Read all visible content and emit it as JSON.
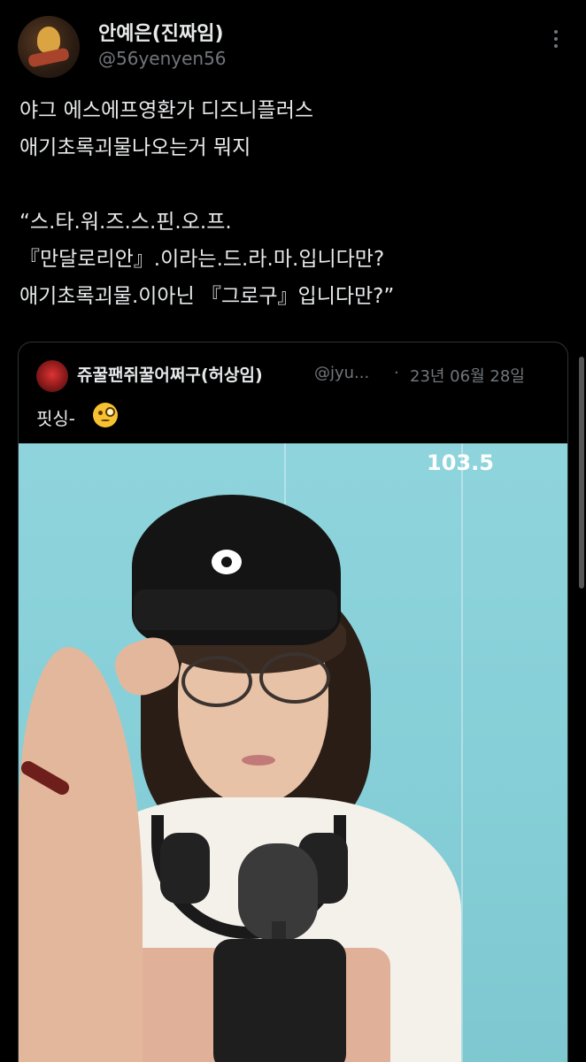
{
  "post": {
    "author": {
      "display_name": "안예은(진짜임)",
      "handle": "@56yenyen56"
    },
    "text_lines": [
      "야그 에스에프영환가 디즈니플러스",
      "애기초록괴물나오는거 뭐지",
      "",
      "“스.타.워.즈.스.핀.오.프.",
      "『만달로리안』.이라는.드.라.마.입니다만?",
      "애기초록괴물.이아닌 『그로구』입니다만?”"
    ]
  },
  "quoted": {
    "author": {
      "display_name": "쥬꿀팬쥐꿀어쩌구(허상임)",
      "handle": "@jyu...",
      "separator": "·",
      "date": "23년 06월 28일"
    },
    "text": "핏싱-",
    "emoji": "face-with-monocle-icon",
    "media": {
      "overlay_text": "103.5"
    }
  },
  "colors": {
    "background": "#000000",
    "text_primary": "#e7e9ea",
    "text_secondary": "#71767b",
    "border": "#2f3336"
  }
}
